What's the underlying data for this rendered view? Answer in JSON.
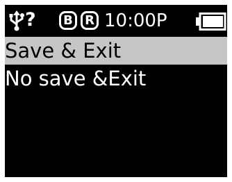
{
  "status_bar": {
    "unknown_glyph": "?",
    "badge_b": "B",
    "badge_r": "R",
    "time": "10:00P"
  },
  "menu": {
    "items": [
      {
        "label": "Save & Exit",
        "selected": true
      },
      {
        "label": "No save &Exit",
        "selected": false
      }
    ]
  },
  "colors": {
    "background": "#000000",
    "text": "#ffffff",
    "highlight": "#c6c6c6",
    "highlight_text": "#000000"
  },
  "icons": [
    "usb-icon",
    "battery-icon"
  ]
}
